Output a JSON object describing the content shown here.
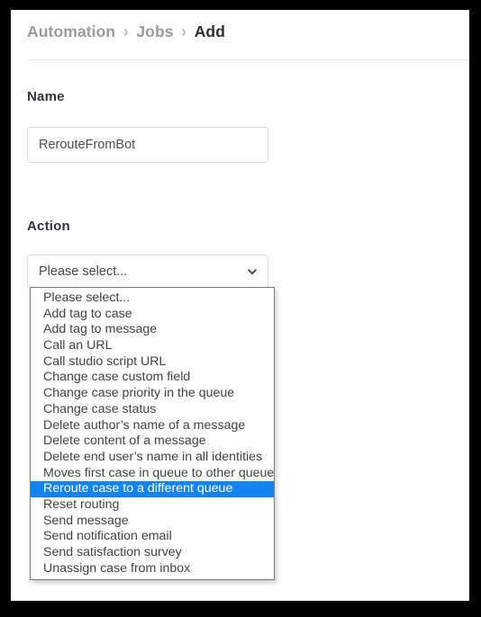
{
  "frame": {
    "background_color": "#000000",
    "page_color": "#ffffff"
  },
  "breadcrumb": {
    "items": [
      {
        "label": "Automation",
        "current": false
      },
      {
        "label": "Jobs",
        "current": false
      },
      {
        "label": "Add",
        "current": true
      }
    ],
    "separator": "›"
  },
  "form": {
    "name": {
      "heading": "Name",
      "value": "RerouteFromBot",
      "placeholder": "Name"
    },
    "action": {
      "heading": "Action",
      "selected_label": "Please select...",
      "chevron_icon": "chevron-down-icon",
      "options": [
        "Please select...",
        "Add tag to case",
        "Add tag to message",
        "Call an URL",
        "Call studio script URL",
        "Change case custom field",
        "Change case priority in the queue",
        "Change case status",
        "Delete author’s name of a message",
        "Delete content of a message",
        "Delete end user’s name in all identities",
        "Moves first case in queue to other queue",
        "Reroute case to a different queue",
        "Reset routing",
        "Send message",
        "Send notification email",
        "Send satisfaction survey",
        "Unassign case from inbox"
      ],
      "highlighted_option": "Reroute case to a different queue",
      "highlight_color": "#1283f0",
      "highlight_text_color": "#ffffff"
    }
  },
  "colors": {
    "breadcrumb_inactive": "#9b9b9b",
    "breadcrumb_active": "#2f3033",
    "heading": "#32363b",
    "input_border": "#dcdcdc",
    "rule": "#e6e6e6"
  }
}
